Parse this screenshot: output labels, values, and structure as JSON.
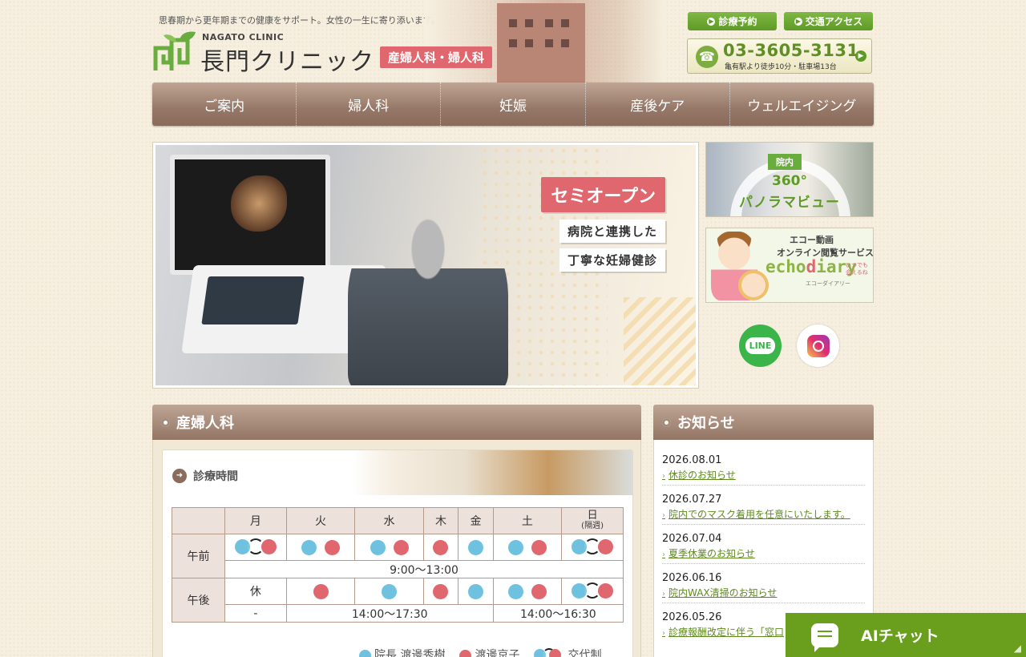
{
  "header": {
    "tagline": "思春期から更年期までの健康をサポート。女性の一生に寄り添います。",
    "logo_en": "NAGATO CLINIC",
    "logo_jp": "長門クリニック",
    "dept_badge": "産婦人科・婦人科",
    "btn_reservation": "診療予約",
    "btn_access": "交通アクセス",
    "phone": "03-3605-3131",
    "phone_sub": "亀有駅より徒歩10分・駐車場13台"
  },
  "nav": {
    "items": [
      "ご案内",
      "婦人科",
      "妊娠",
      "産後ケア",
      "ウェルエイジング"
    ]
  },
  "hero": {
    "tag": "セミオープン",
    "line1": "病院と連携した",
    "line2": "丁寧な妊婦健診"
  },
  "banners": {
    "pano_badge": "院内",
    "pano_line1": "360°",
    "pano_line2": "パノラマビュー",
    "echo_line1": "エコー動画",
    "echo_line2": "オンライン閲覧サービス",
    "echo_logo_a": "echo",
    "echo_logo_b": "d",
    "echo_logo_c": "iary",
    "echo_small1": "いつでも",
    "echo_small2": "会えるね",
    "echo_sub": "エコーダイアリー",
    "line_label": "LINE"
  },
  "obstetrics": {
    "heading": "産婦人科",
    "card_title": "診療時間",
    "days": [
      "月",
      "火",
      "水",
      "木",
      "金",
      "土",
      "日"
    ],
    "sunday_note": "(隔週)",
    "am_label": "午前",
    "pm_label": "午後",
    "am_time": "9:00〜13:00",
    "pm_closed": "休",
    "pm_time_a": "-",
    "pm_time_b": "14:00〜17:30",
    "pm_time_c": "14:00〜16:30",
    "legend_blue": "院長 渡邊秀樹",
    "legend_red": "渡邊京子",
    "legend_rot": "交代制"
  },
  "news": {
    "heading": "お知らせ",
    "items": [
      {
        "date": "2026.08.01",
        "title": "休診のお知らせ"
      },
      {
        "date": "2026.07.27",
        "title": "院内でのマスク着用を任意にいたします。"
      },
      {
        "date": "2026.07.04",
        "title": "夏季休業のお知らせ"
      },
      {
        "date": "2026.06.16",
        "title": "院内WAX清掃のお知らせ"
      },
      {
        "date": "2026.05.26",
        "title": "診療報酬改定に伴う「窓口"
      }
    ]
  },
  "ai_chat": {
    "label": "AIチャット"
  },
  "colors": {
    "accent_green": "#6a9f1e",
    "accent_pink": "#e0676d",
    "nav_brown": "#967868",
    "doc_blue": "#6ec2e0"
  }
}
